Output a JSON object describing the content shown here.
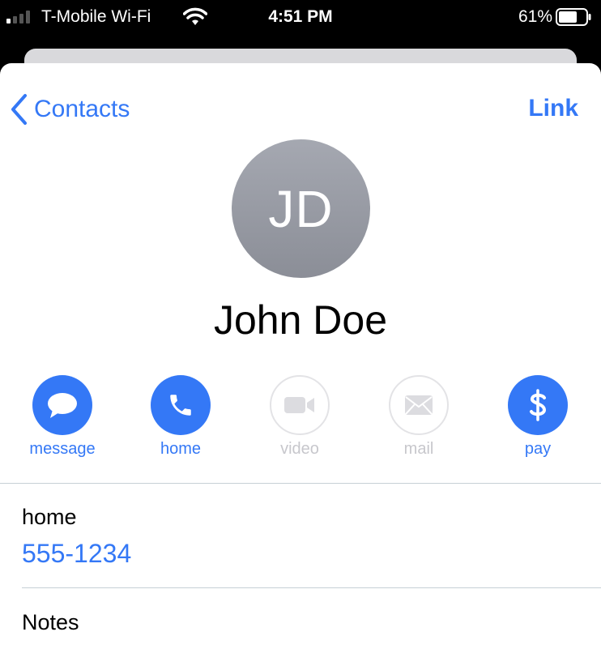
{
  "status_bar": {
    "carrier": "T-Mobile Wi-Fi",
    "time": "4:51 PM",
    "battery_percent": "61%"
  },
  "nav": {
    "back_label": "Contacts",
    "link_label": "Link"
  },
  "contact": {
    "initials": "JD",
    "name": "John Doe"
  },
  "actions": [
    {
      "label": "message",
      "enabled": true,
      "icon": "message-bubble-icon"
    },
    {
      "label": "home",
      "enabled": true,
      "icon": "phone-icon"
    },
    {
      "label": "video",
      "enabled": false,
      "icon": "video-camera-icon"
    },
    {
      "label": "mail",
      "enabled": false,
      "icon": "envelope-icon"
    },
    {
      "label": "pay",
      "enabled": true,
      "icon": "dollar-icon"
    }
  ],
  "phone": {
    "label": "home",
    "number": "555-1234"
  },
  "notes": {
    "label": "Notes"
  },
  "colors": {
    "accent": "#3478f6",
    "disabled": "#c7c7cc",
    "avatar": "#9a9da6"
  }
}
